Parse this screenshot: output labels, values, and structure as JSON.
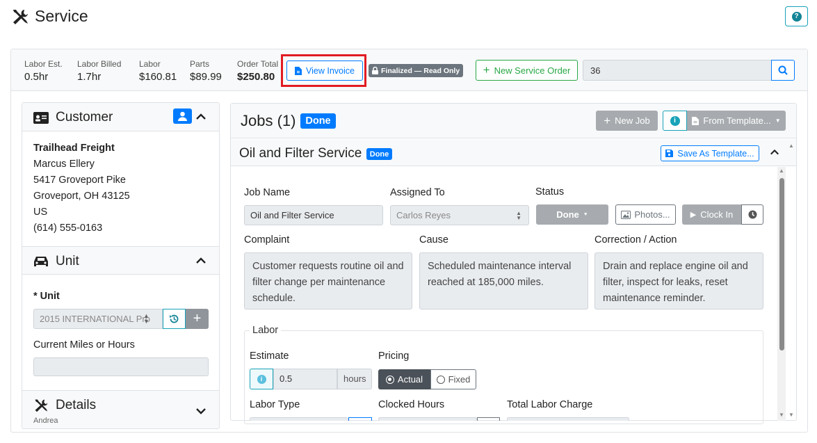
{
  "header": {
    "title": "Service"
  },
  "summary": {
    "labor_est": {
      "label": "Labor Est.",
      "value": "0.5hr"
    },
    "labor_billed": {
      "label": "Labor Billed",
      "value": "1.7hr"
    },
    "labor": {
      "label": "Labor",
      "value": "$160.81"
    },
    "parts": {
      "label": "Parts",
      "value": "$89.99"
    },
    "order_total": {
      "label": "Order Total",
      "value": "$250.80"
    },
    "view_invoice": "View Invoice",
    "finalized_badge": "Finalized — Read Only",
    "new_service_order": "New Service Order",
    "order_search_value": "36"
  },
  "customer": {
    "title": "Customer",
    "company": "Trailhead Freight",
    "contact": "Marcus Ellery",
    "address1": "5417 Groveport Pike",
    "address2": "Groveport, OH 43125",
    "country": "US",
    "phone": "(614) 555-0163"
  },
  "unit": {
    "title": "Unit",
    "unit_label": "* Unit",
    "unit_value": "2015 INTERNATIONAL Pro",
    "miles_label": "Current Miles or Hours",
    "miles_value": ""
  },
  "details": {
    "title": "Details",
    "subtitle": "Andrea"
  },
  "jobs": {
    "title": "Jobs (1)",
    "status_badge": "Done",
    "new_job": "New Job",
    "from_template": "From Template..."
  },
  "job": {
    "title": "Oil and Filter Service",
    "status_badge": "Done",
    "save_template": "Save As Template...",
    "job_name_label": "Job Name",
    "job_name_value": "Oil and Filter Service",
    "assigned_label": "Assigned To",
    "assigned_value": "Carlos Reyes",
    "status_label": "Status",
    "status_value": "Done",
    "photos": "Photos...",
    "clock_in": "Clock In",
    "complaint_label": "Complaint",
    "complaint_value": "Customer requests routine oil and filter change per maintenance schedule.",
    "cause_label": "Cause",
    "cause_value": "Scheduled maintenance interval reached at 185,000 miles.",
    "correction_label": "Correction / Action",
    "correction_value": "Drain and replace engine oil and filter, inspect for leaks, reset maintenance reminder."
  },
  "labor": {
    "legend": "Labor",
    "estimate_label": "Estimate",
    "estimate_value": "0.5",
    "estimate_unit": "hours",
    "pricing_label": "Pricing",
    "pricing_actual": "Actual",
    "pricing_fixed": "Fixed",
    "labor_type_label": "Labor Type",
    "clocked_hours_label": "Clocked Hours",
    "total_charge_label": "Total Labor Charge"
  },
  "colors": {
    "primary": "#007bff",
    "success": "#28a745",
    "info": "#17a2b8",
    "highlight": "#e11b22",
    "secondary": "#6c757d"
  }
}
